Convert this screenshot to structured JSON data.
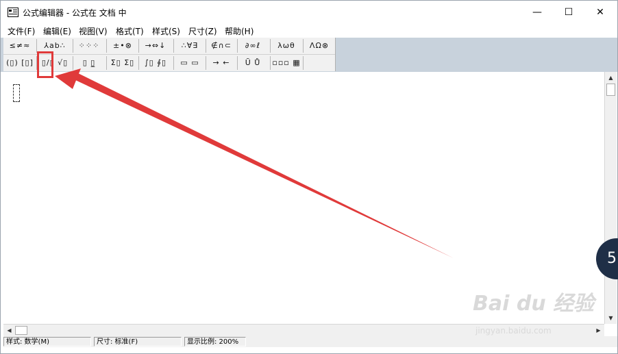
{
  "window": {
    "title": "公式编辑器 - 公式在 文档 中",
    "icon": "formula-editor-icon",
    "minimize_label": "—",
    "maximize_label": "☐",
    "close_label": "✕"
  },
  "menu": [
    "文件(F)",
    "编辑(E)",
    "视图(V)",
    "格式(T)",
    "样式(S)",
    "尺寸(Z)",
    "帮助(H)"
  ],
  "toolbar": {
    "row1": [
      "≤≠≈",
      "⅄ab∴",
      "⁘⁘⁘",
      "±•⊗",
      "→⇔↓",
      "∴∀∃",
      "∉∩⊂",
      "∂∞ℓ",
      "λωθ",
      "ΛΩ⊗"
    ],
    "row2": [
      "(▯) [▯]",
      "▯/▯ √▯",
      "▯ ▯̲",
      "Σ▯ Σ▯",
      "∫▯ ∮▯",
      "▭ ▭",
      "→ ←",
      "Ũ Ů",
      "▫▫▫ ▦"
    ]
  },
  "status": {
    "style": "样式: 数学(M)",
    "size": "尺寸: 标准(F)",
    "zoom": "显示比例: 200%"
  },
  "badge": {
    "number": "5"
  },
  "watermark": {
    "main": "Bai du 经验",
    "sub": "jingyan.baidu.com"
  },
  "colors": {
    "highlight": "#e03a3a",
    "toolbar_bg": "#c8d2dc"
  }
}
